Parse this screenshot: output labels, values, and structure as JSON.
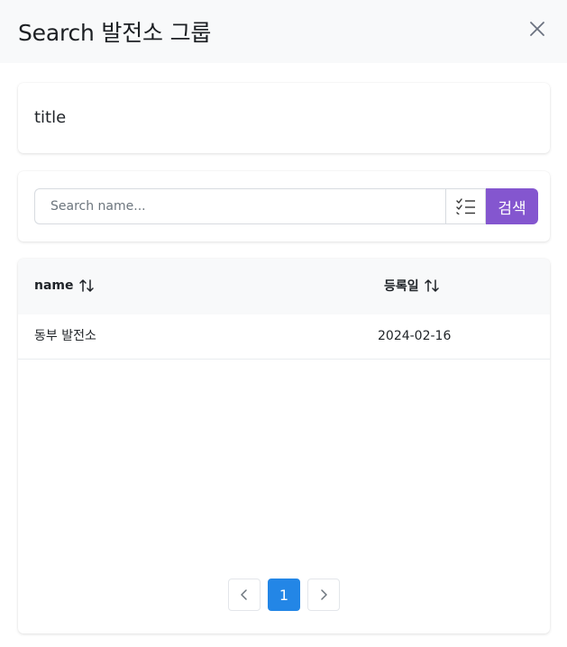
{
  "dialog": {
    "title": "Search 발전소 그룹"
  },
  "title_card": {
    "text": "title"
  },
  "search": {
    "placeholder": "Search name...",
    "button_label": "검색"
  },
  "table": {
    "columns": [
      {
        "label": "name"
      },
      {
        "label": "등록일"
      }
    ],
    "rows": [
      {
        "name": "동부 발전소",
        "date": "2024-02-16"
      }
    ]
  },
  "pagination": {
    "current_page": "1"
  },
  "colors": {
    "accent_purple": "#8456cf",
    "page_active": "#2386e6",
    "header_bg": "#f8f9fa"
  },
  "icons": [
    "close-icon",
    "checklist-icon",
    "sort-icon",
    "chevron-left-icon",
    "chevron-right-icon"
  ]
}
